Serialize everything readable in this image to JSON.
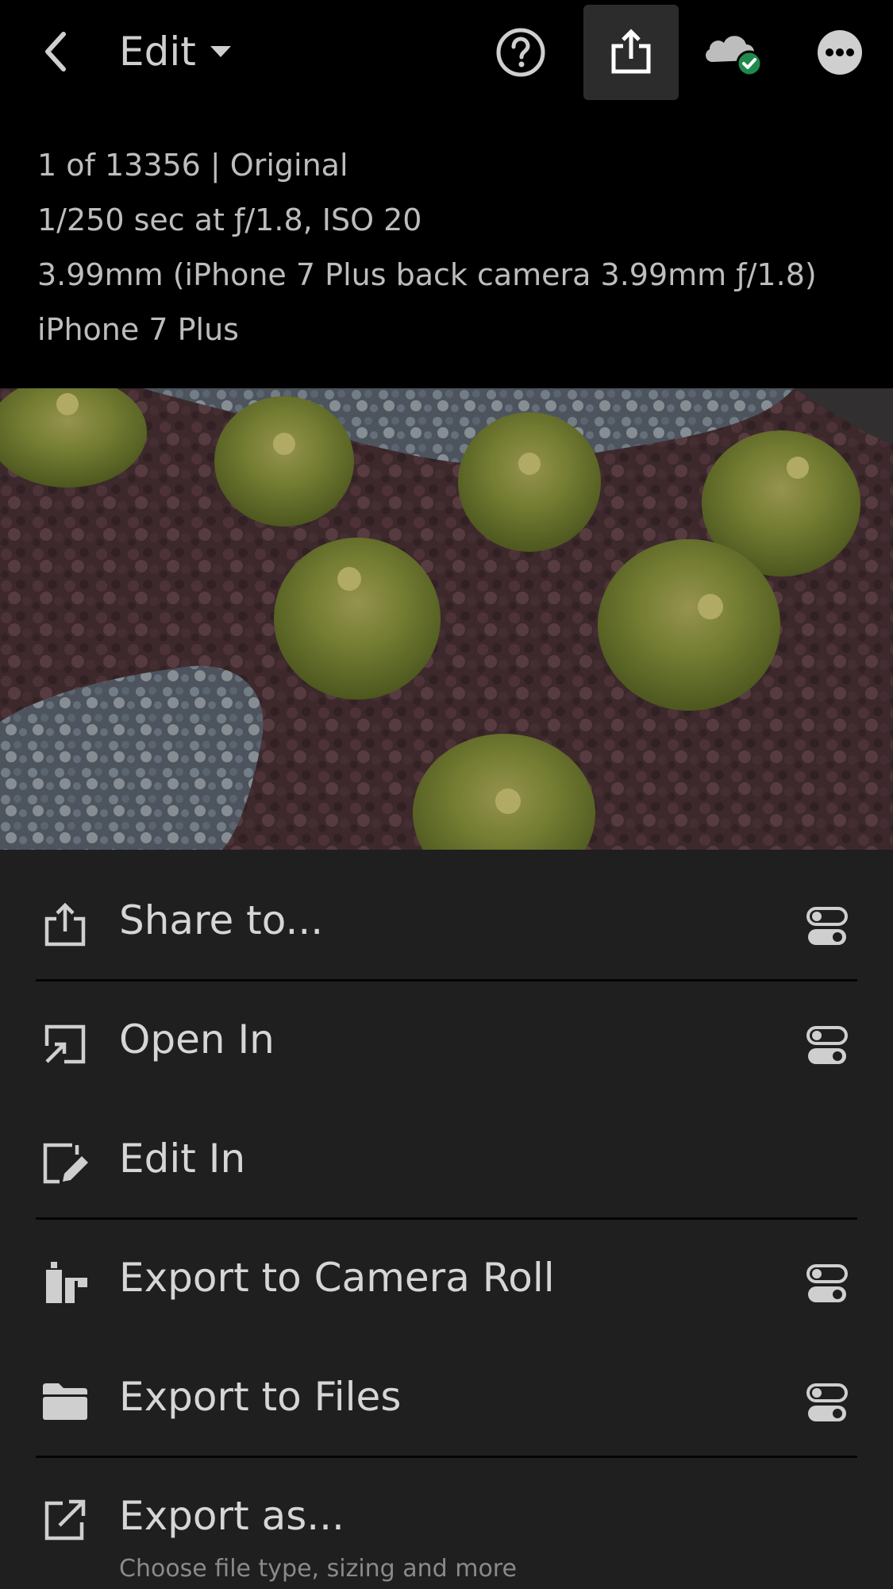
{
  "topbar": {
    "mode_label": "Edit",
    "icons": [
      "back-chevron-icon",
      "help-icon",
      "share-icon",
      "cloud-synced-icon",
      "more-icon"
    ],
    "accent_color": "#1f8a4c"
  },
  "info": {
    "line1": "1 of 13356 | Original",
    "line2": "1/250 sec at ƒ/1.8, ISO 20",
    "line3": "3.99mm (iPhone 7 Plus back camera 3.99mm ƒ/1.8)",
    "line4": "iPhone 7 Plus"
  },
  "menu": {
    "items": [
      {
        "label": "Share to...",
        "icon": "share-icon",
        "has_settings": true
      },
      {
        "label": "Open In",
        "icon": "open-in-icon",
        "has_settings": true
      },
      {
        "label": "Edit In",
        "icon": "edit-in-icon",
        "has_settings": false
      },
      {
        "label": "Export to Camera Roll",
        "icon": "camera-roll-icon",
        "has_settings": true
      },
      {
        "label": "Export to Files",
        "icon": "folder-icon",
        "has_settings": true
      },
      {
        "label": "Export as...",
        "sublabel": "Choose file type, sizing and more",
        "icon": "export-icon",
        "has_settings": false
      }
    ]
  }
}
